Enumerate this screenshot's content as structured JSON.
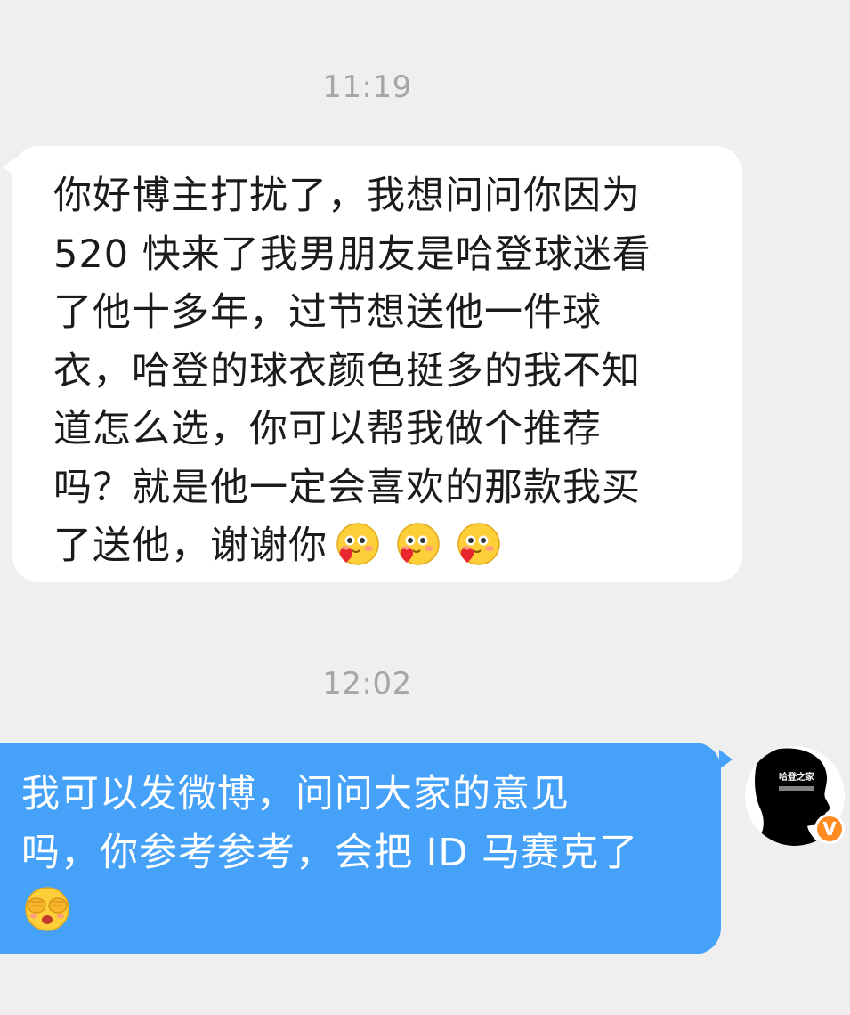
{
  "conversation": {
    "timestamps": [
      "11:19",
      "12:02"
    ],
    "incoming_message": {
      "lines": [
        "你好博主打扰了，我想问问你因为",
        "520 快来了我男朋友是哈登球迷看",
        "了他十多年，过节想送他一件球",
        "衣，哈登的球衣颜色挺多的我不知",
        "道怎么选，你可以帮我做个推荐",
        "吗？就是他一定会喜欢的那款我买",
        "了送他，谢谢你"
      ],
      "trailing_emoji": "heart-hug-emoji",
      "trailing_emoji_count": 3
    },
    "outgoing_message": {
      "lines": [
        "我可以发微博，问问大家的意见",
        "吗，你参考参考，会把 ID 马赛克了"
      ],
      "trailing_emoji": "cover-eyes-emoji"
    },
    "sender_avatar": {
      "label": "哈登之家",
      "badge": "V",
      "badge_color": "#ff8b23"
    }
  },
  "colors": {
    "background": "#efefef",
    "incoming_bubble": "#ffffff",
    "outgoing_bubble": "#46a2f9",
    "timestamp_text": "#a6a6a6"
  }
}
